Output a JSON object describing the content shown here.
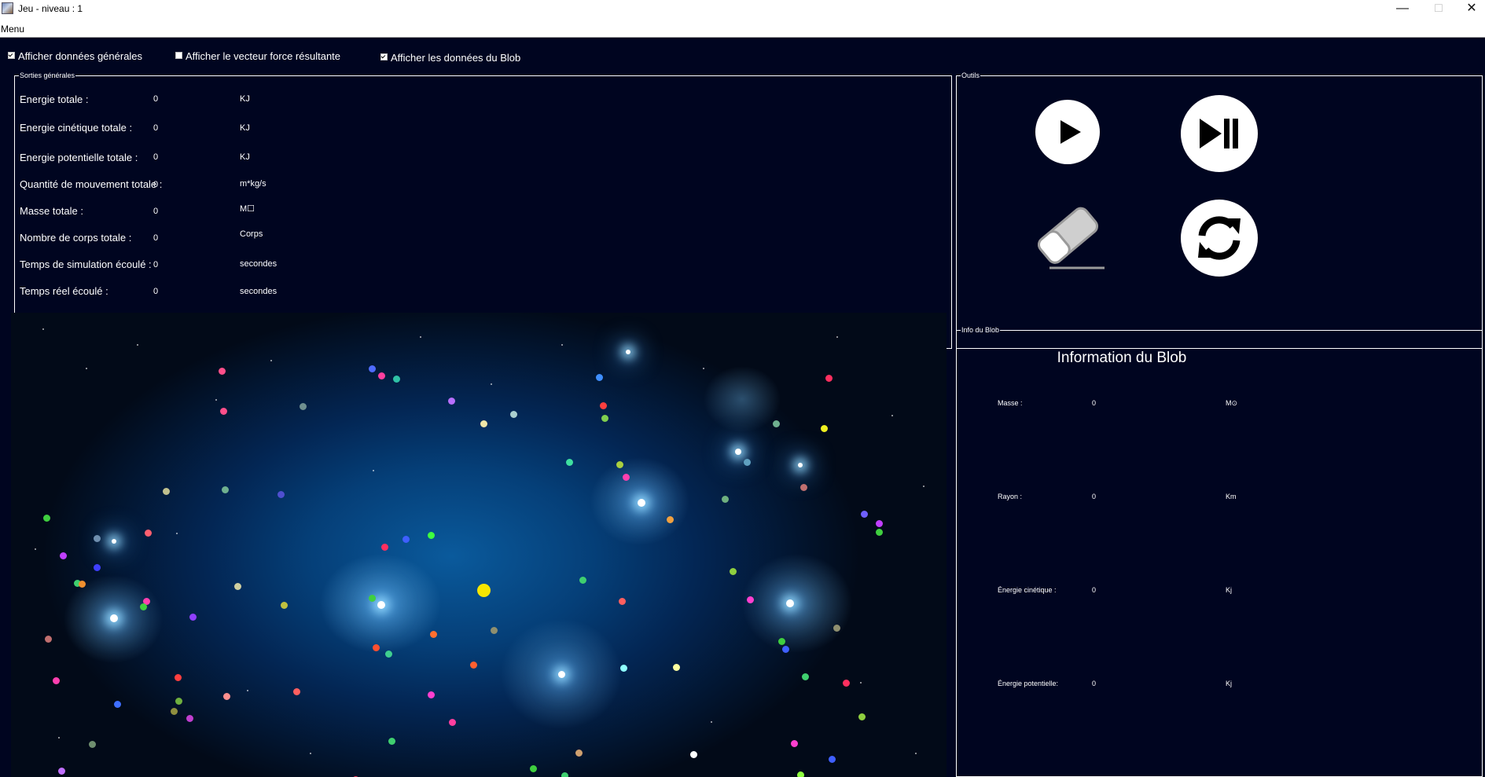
{
  "window": {
    "title": "Jeu  - niveau : 1",
    "minimize": "—",
    "maximize": "□",
    "close": "✕"
  },
  "menu": {
    "label": "Menu"
  },
  "toggles": [
    {
      "label": "Afficher données générales",
      "checked": true
    },
    {
      "label": "Afficher le vecteur force résultante",
      "checked": false
    },
    {
      "label": "Afficher les données du Blob",
      "checked": true
    }
  ],
  "general_panel": {
    "legend": "Sorties générales",
    "rows": [
      {
        "label": "Energie totale :",
        "value": "0",
        "unit": "KJ"
      },
      {
        "label": "Energie cinétique totale :",
        "value": "0",
        "unit": "KJ"
      },
      {
        "label": "Energie potentielle totale :",
        "value": "0",
        "unit": "KJ"
      },
      {
        "label": "Quantité de mouvement totale :",
        "value": "0",
        "unit": "m*kg/s"
      },
      {
        "label": "Masse totale :",
        "value": "0",
        "unit": "M☐"
      },
      {
        "label": "Nombre de corps totale :",
        "value": "0",
        "unit": "Corps"
      },
      {
        "label": "Temps de simulation écoulé :",
        "value": "0",
        "unit": "secondes"
      },
      {
        "label": "Temps réel écoulé :",
        "value": "0",
        "unit": "secondes"
      }
    ]
  },
  "tools_panel": {
    "legend": "Outils",
    "icons": [
      "play-icon",
      "play-pause-icon",
      "eraser-icon",
      "refresh-icon"
    ]
  },
  "blob_panel": {
    "legend": "Info du Blob",
    "title": "Information du Blob",
    "rows": [
      {
        "label": "Masse :",
        "value": "0",
        "unit": "M⊙"
      },
      {
        "label": "Rayon :",
        "value": "0",
        "unit": "Km"
      },
      {
        "label": "Énergie cinétique :",
        "value": "0",
        "unit": "Kj"
      },
      {
        "label": "Énergie potentielle:",
        "value": "0",
        "unit": "Kj"
      }
    ]
  },
  "colors": {
    "background": "#000520",
    "panel_border": "#ffffff",
    "blob": "#f7e600"
  }
}
